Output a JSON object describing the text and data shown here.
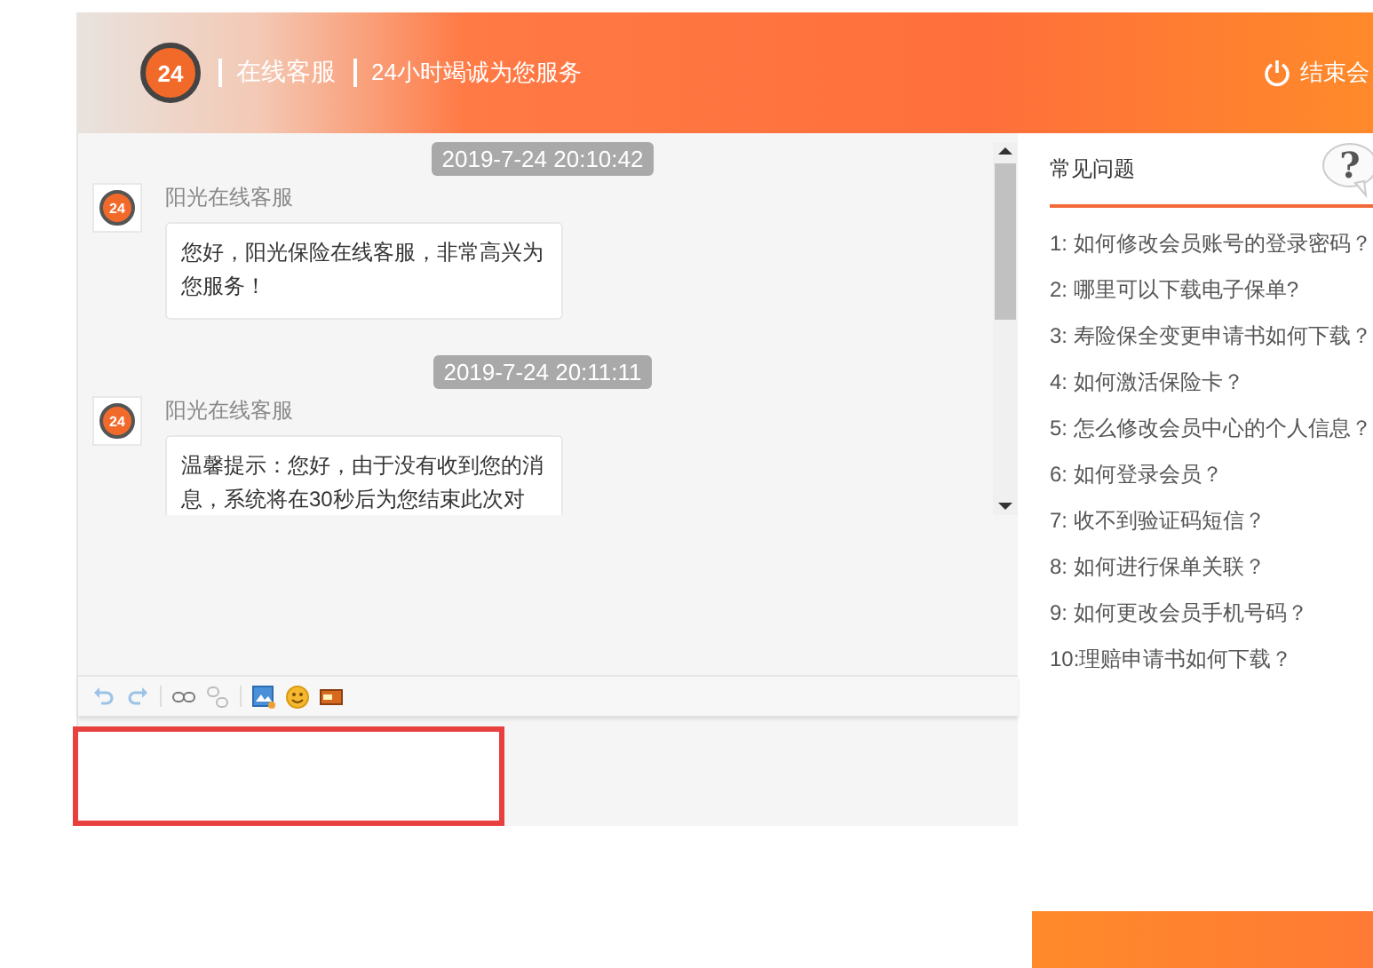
{
  "header": {
    "logo_text": "24",
    "title": "在线客服",
    "slogan": "24小时竭诚为您服务",
    "end_button": "结束会"
  },
  "chat": {
    "messages": [
      {
        "time": "2019-7-24 20:10:42",
        "sender": "阳光在线客服",
        "avatar_text": "24",
        "text": "您好，阳光保险在线客服，非常高兴为您服务！"
      },
      {
        "time": "2019-7-24 20:11:11",
        "sender": "阳光在线客服",
        "avatar_text": "24",
        "text": "温馨提示：您好，由于没有收到您的消息，系统将在30秒后为您结束此次对"
      }
    ]
  },
  "faq": {
    "title": "常见问题",
    "help_mark": "?",
    "items": [
      "1: 如何修改会员账号的登录密码？",
      "2: 哪里可以下载电子保单?",
      "3: 寿险保全变更申请书如何下载？",
      "4: 如何激活保险卡？",
      "5: 怎么修改会员中心的个人信息？",
      "6: 如何登录会员？",
      "7: 收不到验证码短信？",
      "8: 如何进行保单关联？",
      "9: 如何更改会员手机号码？",
      "10:理赔申请书如何下载？"
    ]
  }
}
